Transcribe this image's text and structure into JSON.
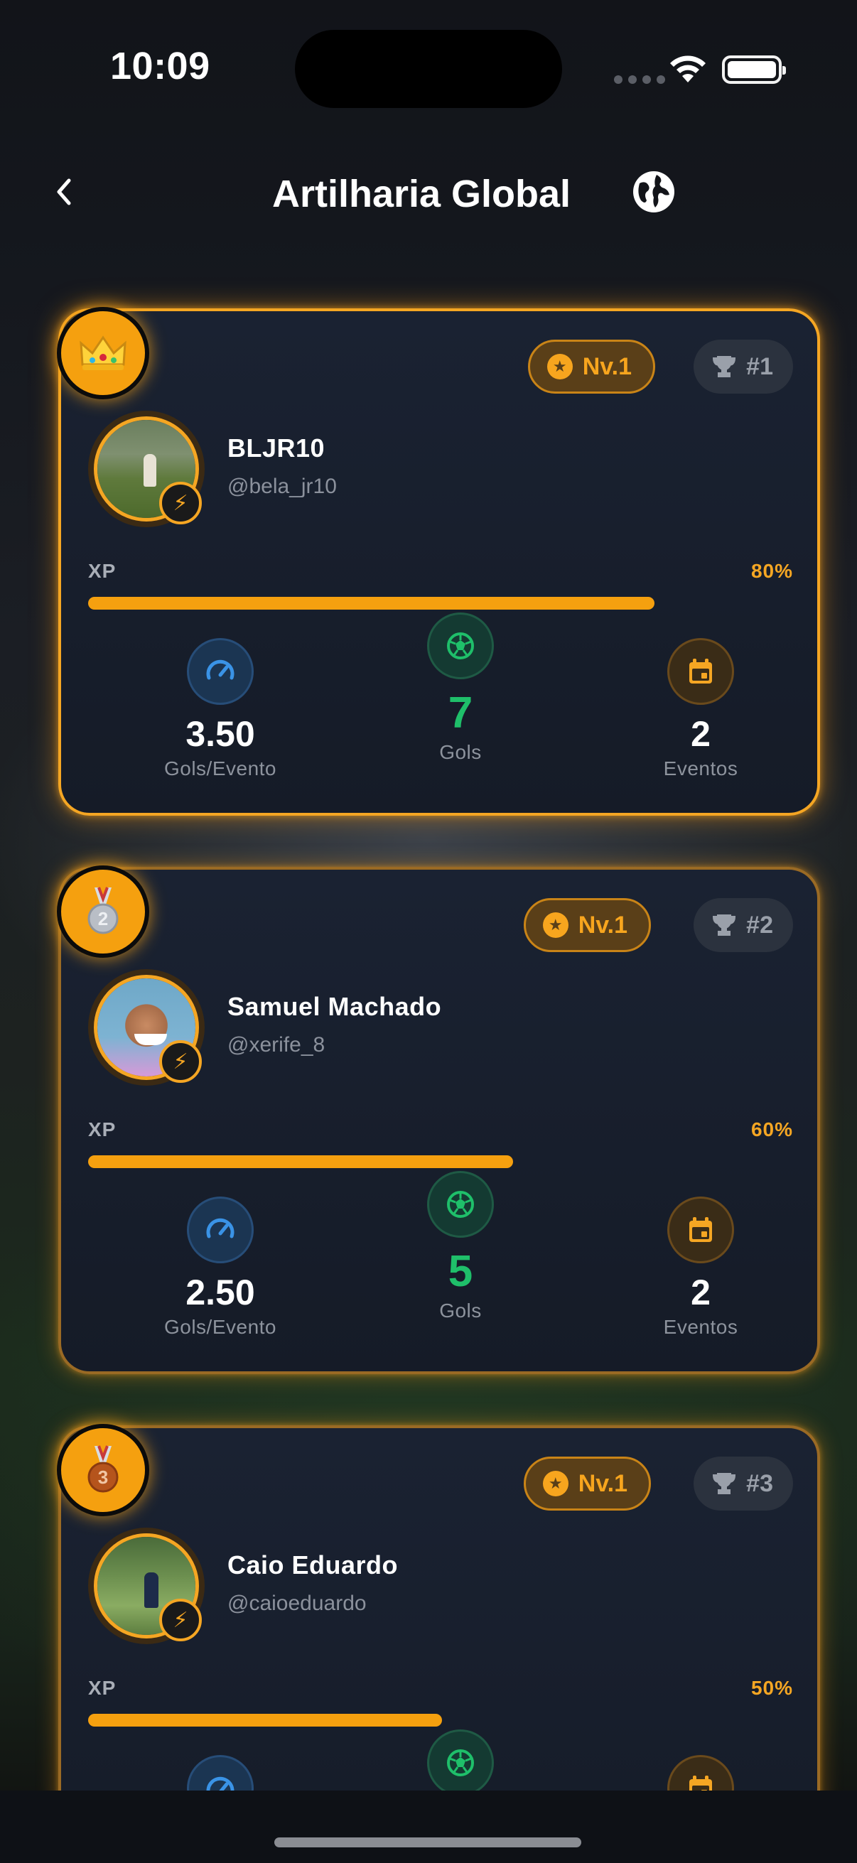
{
  "status_bar": {
    "time": "10:09"
  },
  "header": {
    "title": "Artilharia Global"
  },
  "players": [
    {
      "name": "BLJR10",
      "handle": "@bela_jr10",
      "level": "Nv.1",
      "rank": "#1",
      "medal_icon": "crown",
      "xp_label": "XP",
      "xp_percent": "80%",
      "xp_fraction": 0.8,
      "goals_per_event": "3.50",
      "goals_per_event_label": "Gols/Evento",
      "goals": "7",
      "goals_label": "Gols",
      "events": "2",
      "events_label": "Eventos"
    },
    {
      "name": "Samuel Machado",
      "handle": "@xerife_8",
      "level": "Nv.1",
      "rank": "#2",
      "medal_icon": "silver-medal",
      "medal_number": "2",
      "xp_label": "XP",
      "xp_percent": "60%",
      "xp_fraction": 0.6,
      "goals_per_event": "2.50",
      "goals_per_event_label": "Gols/Evento",
      "goals": "5",
      "goals_label": "Gols",
      "events": "2",
      "events_label": "Eventos"
    },
    {
      "name": "Caio Eduardo",
      "handle": "@caioeduardo",
      "level": "Nv.1",
      "rank": "#3",
      "medal_icon": "bronze-medal",
      "medal_number": "3",
      "xp_label": "XP",
      "xp_percent": "50%",
      "xp_fraction": 0.5
    }
  ],
  "colors": {
    "accent": "#f5a623",
    "goals_green": "#1fbf6a",
    "card_bg": "#1a2232"
  }
}
